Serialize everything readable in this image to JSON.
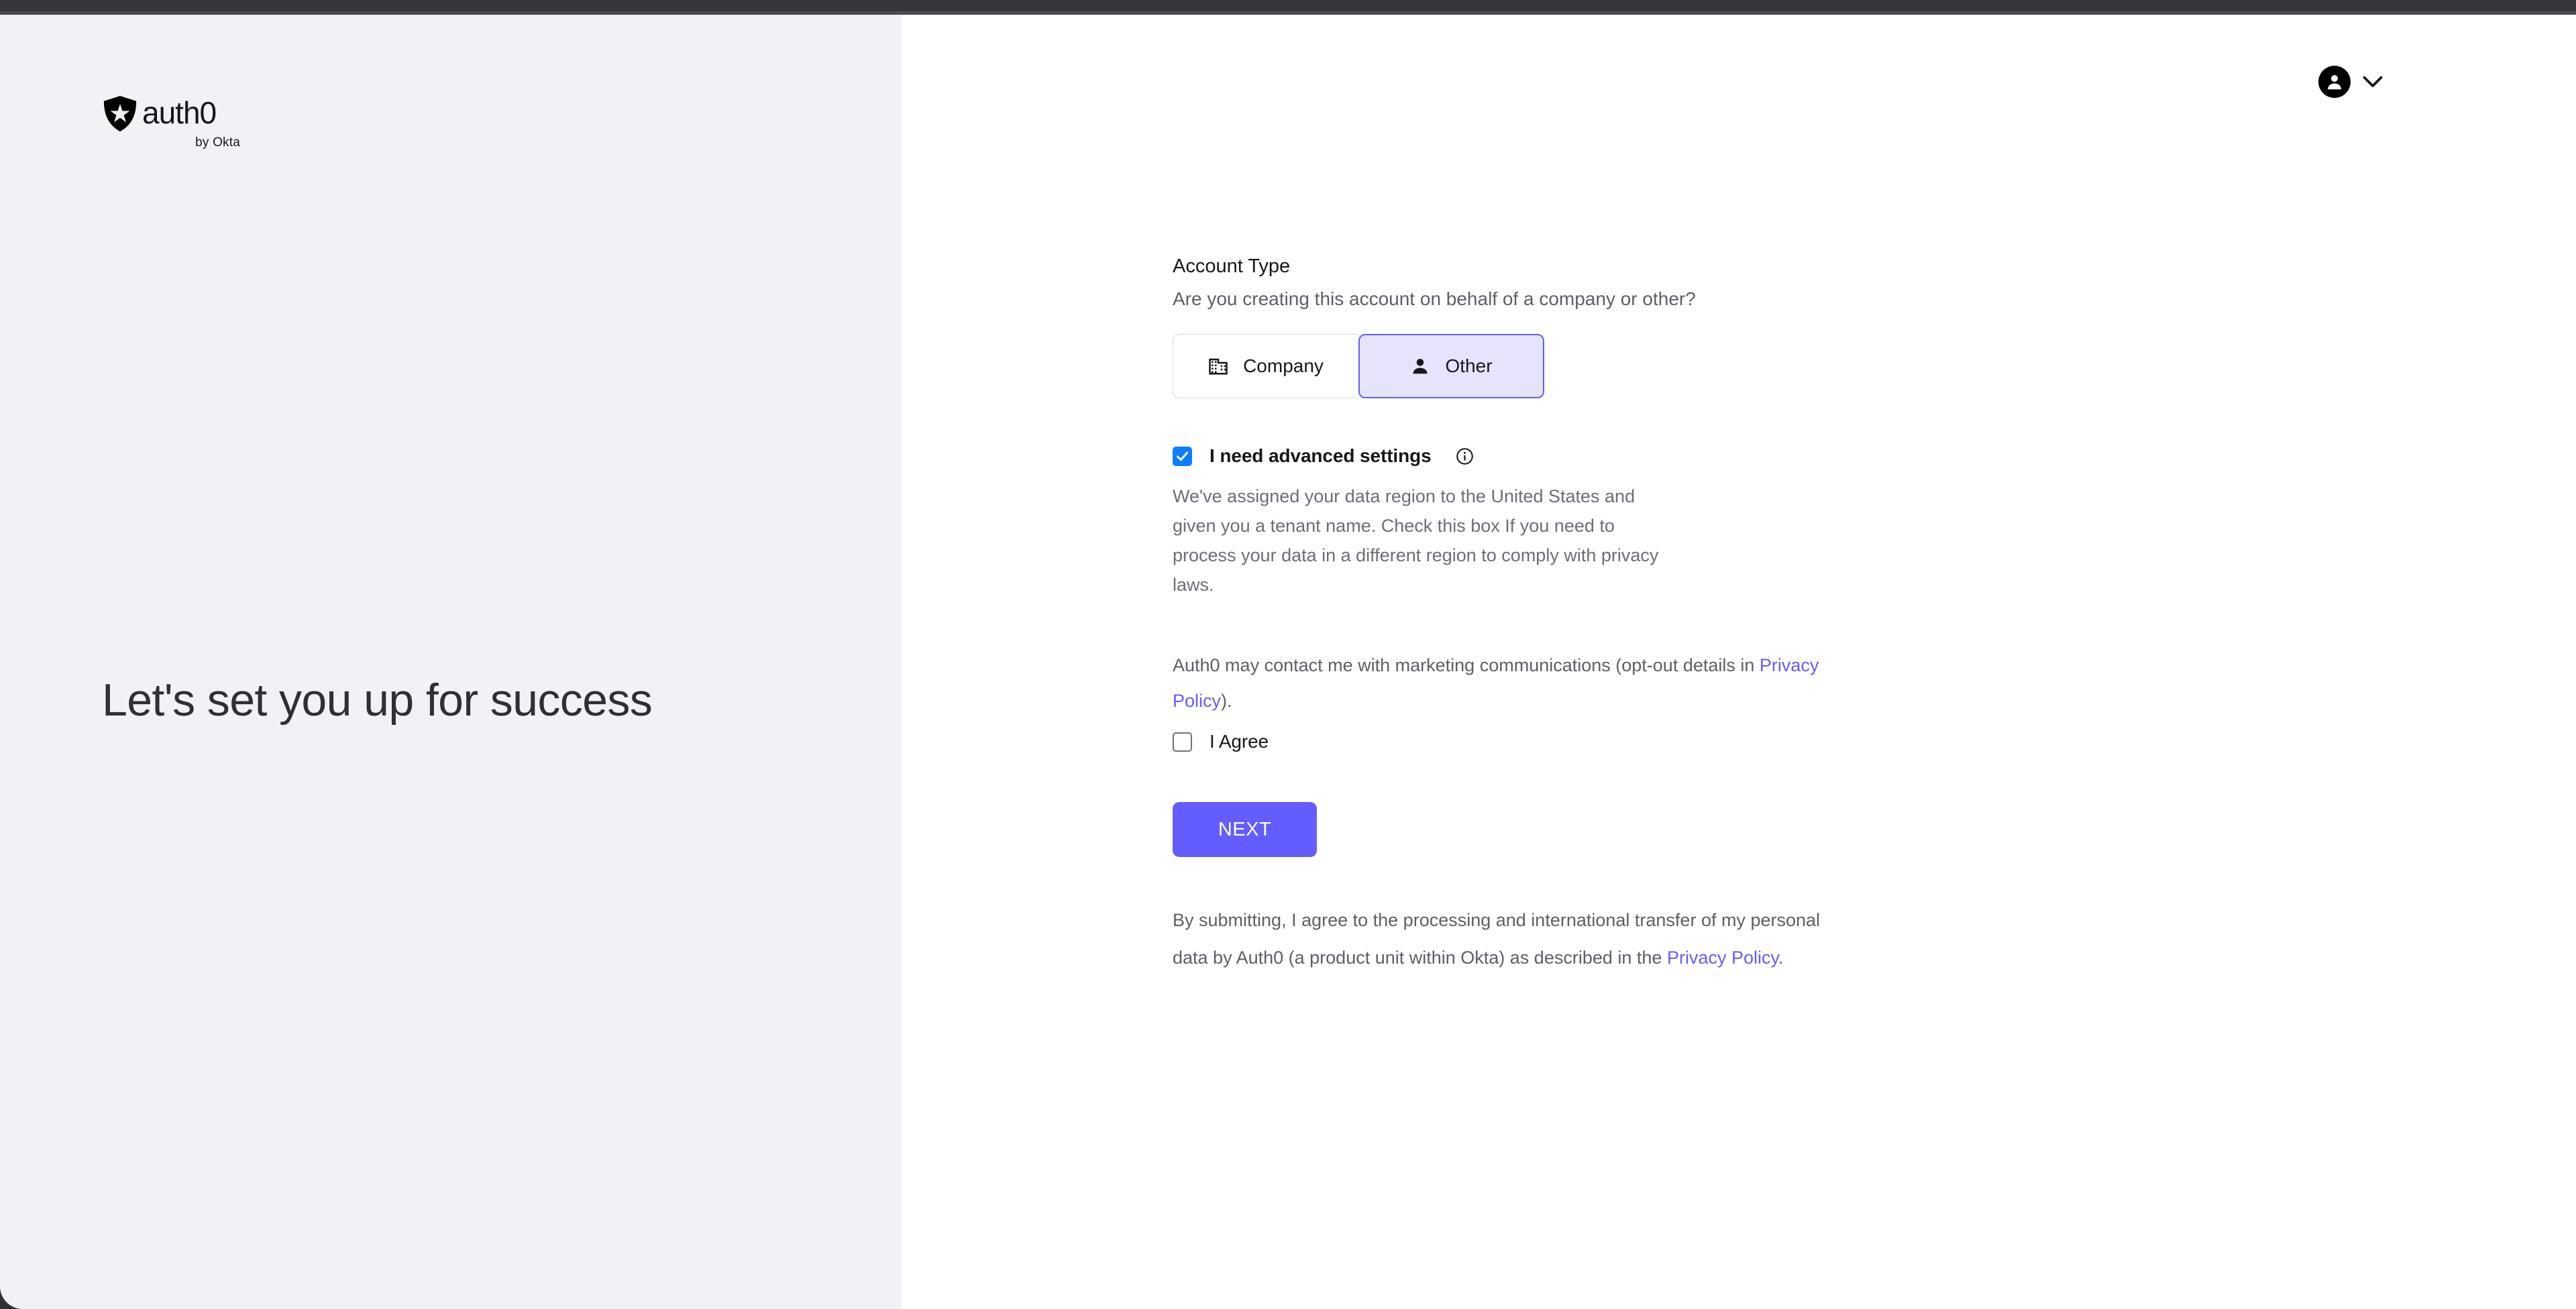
{
  "page": {
    "title": "Let's set you up for success"
  },
  "brand": {
    "name": "auth0",
    "byline": "by Okta",
    "shield_icon": "auth0-shield-icon"
  },
  "account_menu": {
    "avatar_icon": "user-avatar-icon",
    "chevron_icon": "chevron-down-icon"
  },
  "form": {
    "account_type": {
      "label": "Account Type",
      "question": "Are you creating this account on behalf of a company or other?",
      "options": [
        {
          "label": "Company",
          "icon": "building-icon",
          "selected": false
        },
        {
          "label": "Other",
          "icon": "person-icon",
          "selected": true
        }
      ]
    },
    "advanced_settings": {
      "label": "I need advanced settings",
      "checked": true,
      "info_icon": "info-circle-icon",
      "helper": "We've assigned your data region to the United States and given you a tenant name. Check this box If you need to process your data in a different region to comply with privacy laws."
    },
    "marketing": {
      "text_before_link": "Auth0 may contact me with marketing communications (opt-out details in ",
      "link_label": "Privacy Policy",
      "text_after_link": ").",
      "agree": {
        "label": "I Agree",
        "checked": false
      }
    },
    "submit": {
      "label": "NEXT"
    },
    "legal": {
      "text_before_link": "By submitting, I agree to the processing and international transfer of my personal data by Auth0 (a product unit within Okta) as described in the ",
      "link_label": "Privacy Policy",
      "text_after_link": "."
    }
  },
  "colors": {
    "accent_indigo": "#635dff",
    "checkbox_blue": "#0d7dff",
    "panel_gray": "#f1f2f6",
    "selected_fill": "#e6e4fc"
  }
}
